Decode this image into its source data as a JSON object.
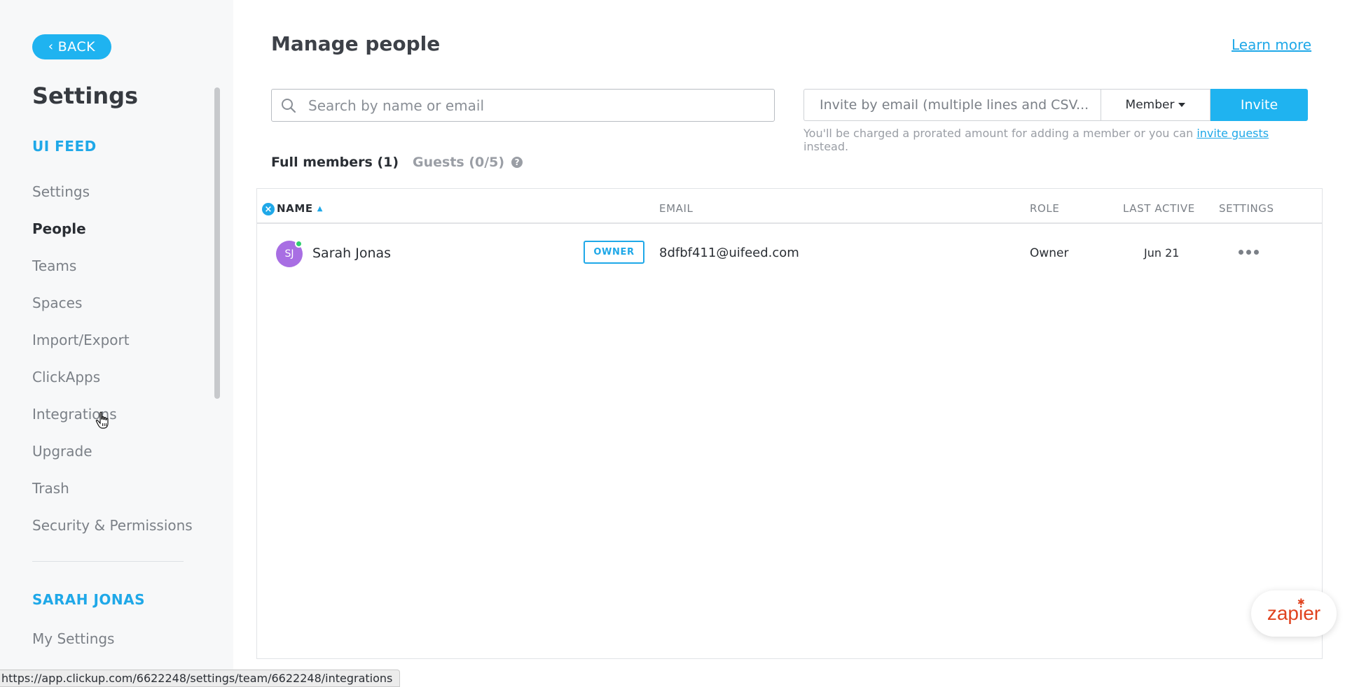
{
  "sidebar": {
    "back_label": "BACK",
    "title": "Settings",
    "workspace": "UI FEED",
    "items": [
      {
        "label": "Settings",
        "active": false
      },
      {
        "label": "People",
        "active": true
      },
      {
        "label": "Teams",
        "active": false
      },
      {
        "label": "Spaces",
        "active": false
      },
      {
        "label": "Import/Export",
        "active": false
      },
      {
        "label": "ClickApps",
        "active": false
      },
      {
        "label": "Integrations",
        "active": false
      },
      {
        "label": "Upgrade",
        "active": false
      },
      {
        "label": "Trash",
        "active": false
      },
      {
        "label": "Security & Permissions",
        "active": false
      }
    ],
    "user_section": "SARAH JONAS",
    "user_items": [
      {
        "label": "My Settings"
      }
    ]
  },
  "header": {
    "title": "Manage people",
    "learn_more": "Learn more"
  },
  "search": {
    "placeholder": "Search by name or email"
  },
  "invite": {
    "placeholder": "Invite by email (multiple lines and CSV...",
    "role_value": "Member",
    "button_label": "Invite",
    "note_prefix": "You'll be charged a prorated amount for adding a member or you can ",
    "note_link": "invite guests",
    "note_suffix": " instead."
  },
  "tabs": {
    "full_members": "Full members (1)",
    "guests": "Guests (0/5)"
  },
  "table": {
    "headers": {
      "name": "NAME",
      "email": "EMAIL",
      "role": "ROLE",
      "last_active": "LAST ACTIVE",
      "settings": "SETTINGS"
    },
    "rows": [
      {
        "initials": "SJ",
        "name": "Sarah Jonas",
        "badge": "OWNER",
        "email": "8dfbf411@uifeed.com",
        "role": "Owner",
        "last_active": "Jun 21",
        "avatar_color": "#a86ee3"
      }
    ]
  },
  "zapier": {
    "label": "zapier"
  },
  "status_bar": {
    "url": "https://app.clickup.com/6622248/settings/team/6622248/integrations"
  },
  "colors": {
    "accent": "#1fb3f0",
    "online": "#2ecf6f",
    "zapier": "#e0431f"
  }
}
